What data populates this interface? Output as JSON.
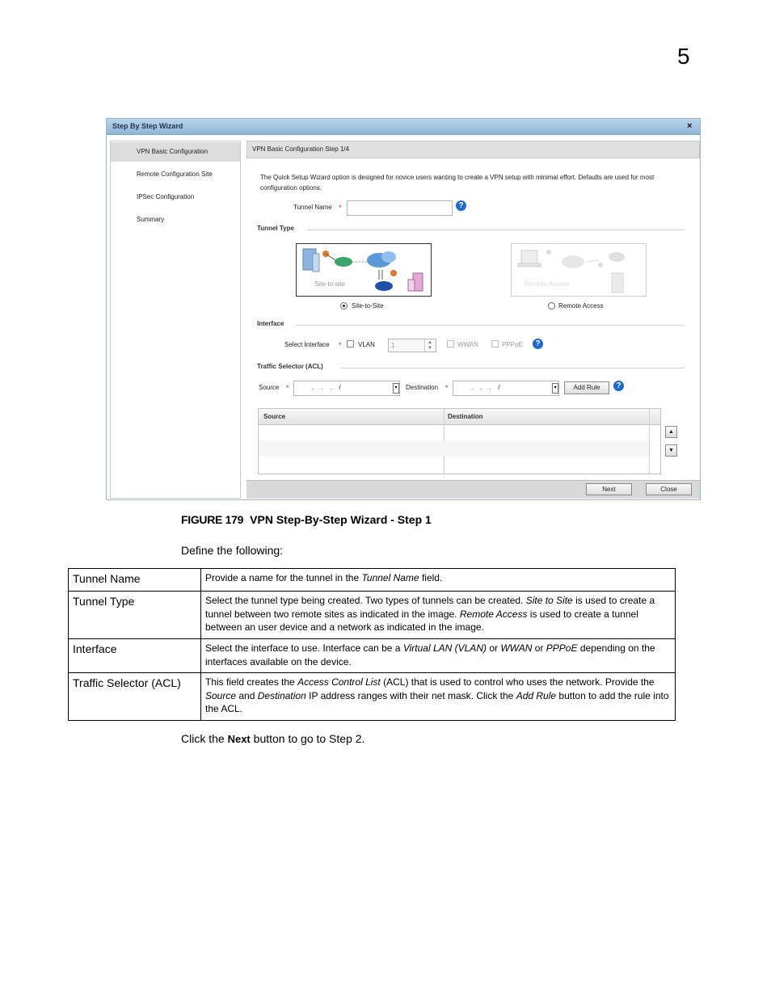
{
  "chapter_number": "5",
  "wizard": {
    "title": "Step By Step Wizard",
    "close_glyph": "×",
    "nav": [
      "VPN Basic Configuration",
      "Remote Configuration Site",
      "IPSec Configuration",
      "Summary"
    ],
    "step_header": "VPN Basic Configuration  Step 1/4",
    "intro": "The Quick Setup Wizard option is designed for novice users wanting to create a VPN setup with minimal effort. Defaults are used for most configuration options.",
    "tunnel_name_label": "Tunnel Name",
    "required_mark": "*",
    "help_glyph": "?",
    "tunnel_type_section": "Tunnel Type",
    "site_to_site_image_label": "Site-to-site",
    "remote_access_image_label": "Remote Access",
    "site_to_site_option": "Site-to-Site",
    "remote_access_option": "Remote Access",
    "interface_section": "Interface",
    "select_interface_label": "Select Interface",
    "vlan_label": "VLAN",
    "vlan_value": "1",
    "wwan_label": "WWAN",
    "pppoe_label": "PPPoE",
    "traffic_section": "Traffic Selector (ACL)",
    "source_label": "Source",
    "destination_label": "Destination",
    "ip_placeholder": ".    .    .    /",
    "add_rule_button": "Add Rule",
    "grid_columns": [
      "Source",
      "Destination"
    ],
    "next_button": "Next",
    "close_button": "Close",
    "colors": {
      "title_bar": "#a9c9e6",
      "help_icon": "#1a6ad1",
      "required": "#d22222"
    }
  },
  "figure": {
    "number": "FIGURE 179",
    "caption": "VPN Step-By-Step Wizard - Step 1"
  },
  "define_text": "Define the following:",
  "definitions": [
    {
      "term": "Tunnel Name",
      "parts": [
        [
          "Provide a name for the tunnel in the ",
          false
        ],
        [
          "Tunnel Name",
          true
        ],
        [
          " field.",
          false
        ]
      ]
    },
    {
      "term": "Tunnel Type",
      "parts": [
        [
          "Select the tunnel type being created. Two types of tunnels can be created. ",
          false
        ],
        [
          "Site to Site",
          true
        ],
        [
          " is used to create a tunnel between two remote sites as indicated in the image. ",
          false
        ],
        [
          "Remote Access",
          true
        ],
        [
          " is used to create a tunnel between an user device and a network as indicated in the image.",
          false
        ]
      ]
    },
    {
      "term": "Interface",
      "parts": [
        [
          "Select the interface to use. Interface can be a ",
          false
        ],
        [
          "Virtual LAN (VLAN)",
          true
        ],
        [
          " or ",
          false
        ],
        [
          "WWAN",
          true
        ],
        [
          " or ",
          false
        ],
        [
          "PPPoE",
          true
        ],
        [
          " depending on the interfaces available on the device.",
          false
        ]
      ]
    },
    {
      "term": "Traffic Selector (ACL)",
      "parts": [
        [
          "This field creates the ",
          false
        ],
        [
          "Access Control List",
          true
        ],
        [
          " (ACL) that is used to control who uses the network. Provide the ",
          false
        ],
        [
          "Source",
          true
        ],
        [
          " and ",
          false
        ],
        [
          "Destination",
          true
        ],
        [
          " IP address ranges with their net mask. Click the ",
          false
        ],
        [
          "Add Rule",
          true
        ],
        [
          " button to add the rule into the ACL.",
          false
        ]
      ]
    }
  ],
  "closing": {
    "before": "Click the ",
    "keyword": "Next",
    "after": " button to go to Step 2."
  }
}
